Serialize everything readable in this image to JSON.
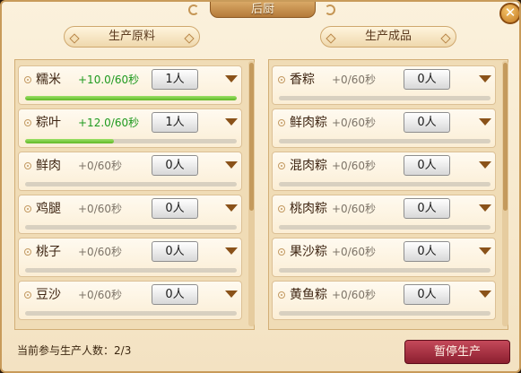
{
  "window": {
    "title": "后厨",
    "close_label": "✕"
  },
  "ingredients": {
    "header": "生产原料",
    "rows": [
      {
        "name": "糯米",
        "rate": "+10.0/60秒",
        "workers": "1人",
        "active": true,
        "progress": 1.0
      },
      {
        "name": "粽叶",
        "rate": "+12.0/60秒",
        "workers": "1人",
        "active": true,
        "progress": 0.42
      },
      {
        "name": "鲜肉",
        "rate": "+0/60秒",
        "workers": "0人",
        "active": false,
        "progress": 0.0
      },
      {
        "name": "鸡腿",
        "rate": "+0/60秒",
        "workers": "0人",
        "active": false,
        "progress": 0.0
      },
      {
        "name": "桃子",
        "rate": "+0/60秒",
        "workers": "0人",
        "active": false,
        "progress": 0.0
      },
      {
        "name": "豆沙",
        "rate": "+0/60秒",
        "workers": "0人",
        "active": false,
        "progress": 0.0
      }
    ]
  },
  "products": {
    "header": "生产成品",
    "rows": [
      {
        "name": "香粽",
        "rate": "+0/60秒",
        "workers": "0人",
        "active": false,
        "progress": 0.0
      },
      {
        "name": "鲜肉粽",
        "rate": "+0/60秒",
        "workers": "0人",
        "active": false,
        "progress": 0.0
      },
      {
        "name": "混肉粽",
        "rate": "+0/60秒",
        "workers": "0人",
        "active": false,
        "progress": 0.0
      },
      {
        "name": "桃肉粽",
        "rate": "+0/60秒",
        "workers": "0人",
        "active": false,
        "progress": 0.0
      },
      {
        "name": "果沙粽",
        "rate": "+0/60秒",
        "workers": "0人",
        "active": false,
        "progress": 0.0
      },
      {
        "name": "黄鱼粽",
        "rate": "+0/60秒",
        "workers": "0人",
        "active": false,
        "progress": 0.0
      }
    ]
  },
  "footer": {
    "participants_label": "当前参与生产人数：",
    "participants_value": "2/3",
    "pause_label": "暂停生产"
  },
  "colors": {
    "rate_active": "#1f9a1f",
    "rate_idle": "#7d7468",
    "progress_fill": "#5fb826",
    "pause_button": "#8c1f2f"
  }
}
